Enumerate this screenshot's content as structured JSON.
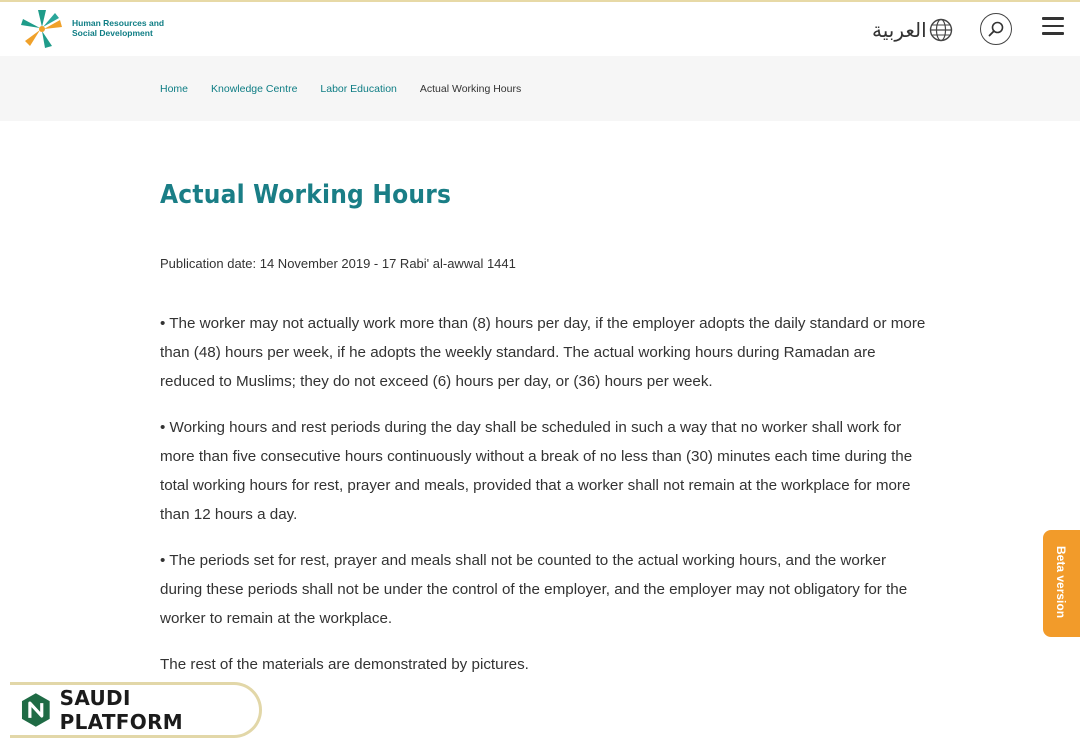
{
  "header": {
    "logo_line1": "Human Resources and",
    "logo_line2": "Social Development",
    "language_label": "العربية",
    "icons": {
      "language": "globe-icon",
      "search": "search-icon",
      "menu": "hamburger-menu-icon"
    }
  },
  "breadcrumb": [
    {
      "label": "Home"
    },
    {
      "label": "Knowledge Centre"
    },
    {
      "label": "Labor Education"
    },
    {
      "label": "Actual Working Hours"
    }
  ],
  "article": {
    "title": "Actual Working Hours",
    "publication_date": "Publication date: 14 November 2019 - 17 Rabi' al-awwal 1441",
    "paragraphs": [
      "• The worker may not actually work more than (8) hours per day, if the employer adopts the daily standard or more than (48) hours per week, if he adopts the weekly standard. The actual working hours during Ramadan are reduced to Muslims; they do not exceed (6) hours per day, or (36) hours per week.",
      "• Working hours and rest periods during the day shall be scheduled in such a way that no worker shall work for more than five consecutive hours continuously without a break of no less than (30) minutes each time during the total working hours for rest, prayer and meals, provided that a worker shall not remain at the workplace for more than 12 hours a day.",
      "• The periods set for rest, prayer and meals shall not be counted to the actual working hours, and the worker during these periods shall not be under the control of the employer, and the employer may not obligatory for the worker to remain at the workplace.",
      "The rest of the materials are demonstrated by pictures."
    ]
  },
  "beta_tab": {
    "label": "Beta version"
  },
  "platform_badge": {
    "label": "SAUDI PLATFORM",
    "icon": "saudi-platform-logo-icon"
  },
  "colors": {
    "accent": "#1a7e86",
    "beta": "#f29b2a",
    "breadcrumb_bg": "#f6f6f6",
    "gold": "#e2d7a8"
  }
}
